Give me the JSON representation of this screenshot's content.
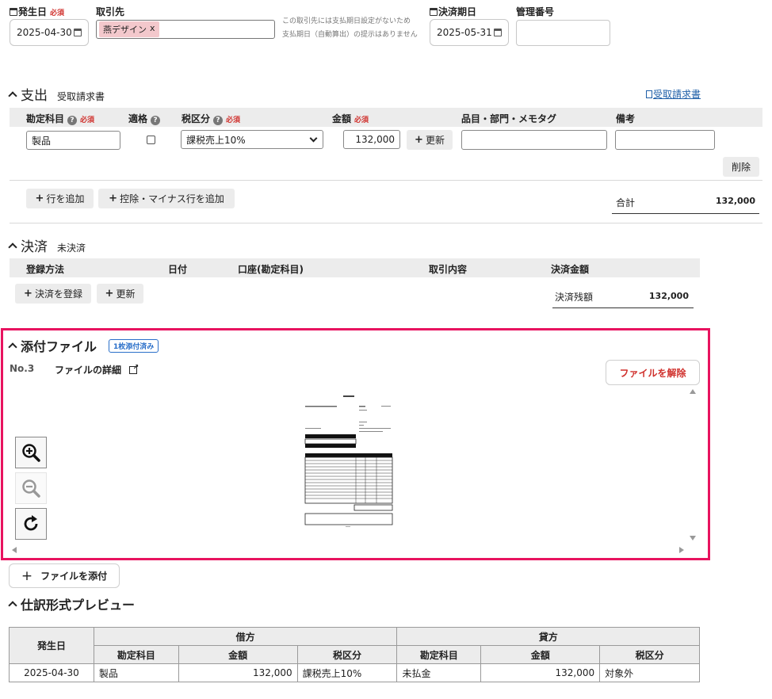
{
  "header": {
    "issue_date_label": "発生日",
    "required": "必須",
    "issue_date_value": "2025-04-30",
    "partner_label": "取引先",
    "partner_tag": "燕デザイン",
    "partner_tag_remove": "x",
    "partner_note_line1": "この取引先には支払期日設定がないため",
    "partner_note_line2": "支払期日（自動算出）の提示はありません",
    "due_date_label": "決済期日",
    "due_date_value": "2025-05-31",
    "mgmt_no_label": "管理番号",
    "mgmt_no_value": ""
  },
  "expense": {
    "title": "支出",
    "subtitle": "受取請求書",
    "link": "受取請求書",
    "columns": {
      "account": "勘定科目",
      "qualified": "適格",
      "tax": "税区分",
      "amount": "金額",
      "item": "品目・部門・メモタグ",
      "note": "備考"
    },
    "row": {
      "account": "製品",
      "tax": "課税売上10%",
      "amount": "132,000",
      "update": "更新",
      "item": "",
      "note": ""
    },
    "delete": "削除",
    "add_row": "行を追加",
    "add_minus_row": "控除・マイナス行を追加",
    "total_label": "合計",
    "total_value": "132,000"
  },
  "settlement": {
    "title": "決済",
    "subtitle": "未決済",
    "columns": {
      "method": "登録方法",
      "date": "日付",
      "account": "口座(勘定科目)",
      "content": "取引内容",
      "amount": "決済金額"
    },
    "register": "決済を登録",
    "update": "更新",
    "balance_label": "決済残額",
    "balance_value": "132,000"
  },
  "attachment": {
    "title": "添付ファイル",
    "badge": "1枚添付済み",
    "number": "No.3",
    "detail": "ファイルの詳細",
    "unlink": "ファイルを解除",
    "add_file": "ファイルを添付",
    "zoom_in_icon": "zoom-in-icon",
    "zoom_out_icon": "zoom-out-icon",
    "rotate_icon": "rotate-icon"
  },
  "journal": {
    "title": "仕訳形式プレビュー",
    "col_date": "発生日",
    "debit": "借方",
    "credit": "貸方",
    "sub_account": "勘定科目",
    "sub_amount": "金額",
    "sub_tax": "税区分",
    "rows": [
      {
        "date": "2025-04-30",
        "debit_account": "製品",
        "debit_amount": "132,000",
        "debit_tax": "課税売上10%",
        "credit_account": "未払金",
        "credit_amount": "132,000",
        "credit_tax": "対象外"
      }
    ]
  },
  "colors": {
    "highlight_border": "#e8135f",
    "required": "#d0312d",
    "link": "#1f5fa8",
    "badge": "#2a6fc9"
  }
}
